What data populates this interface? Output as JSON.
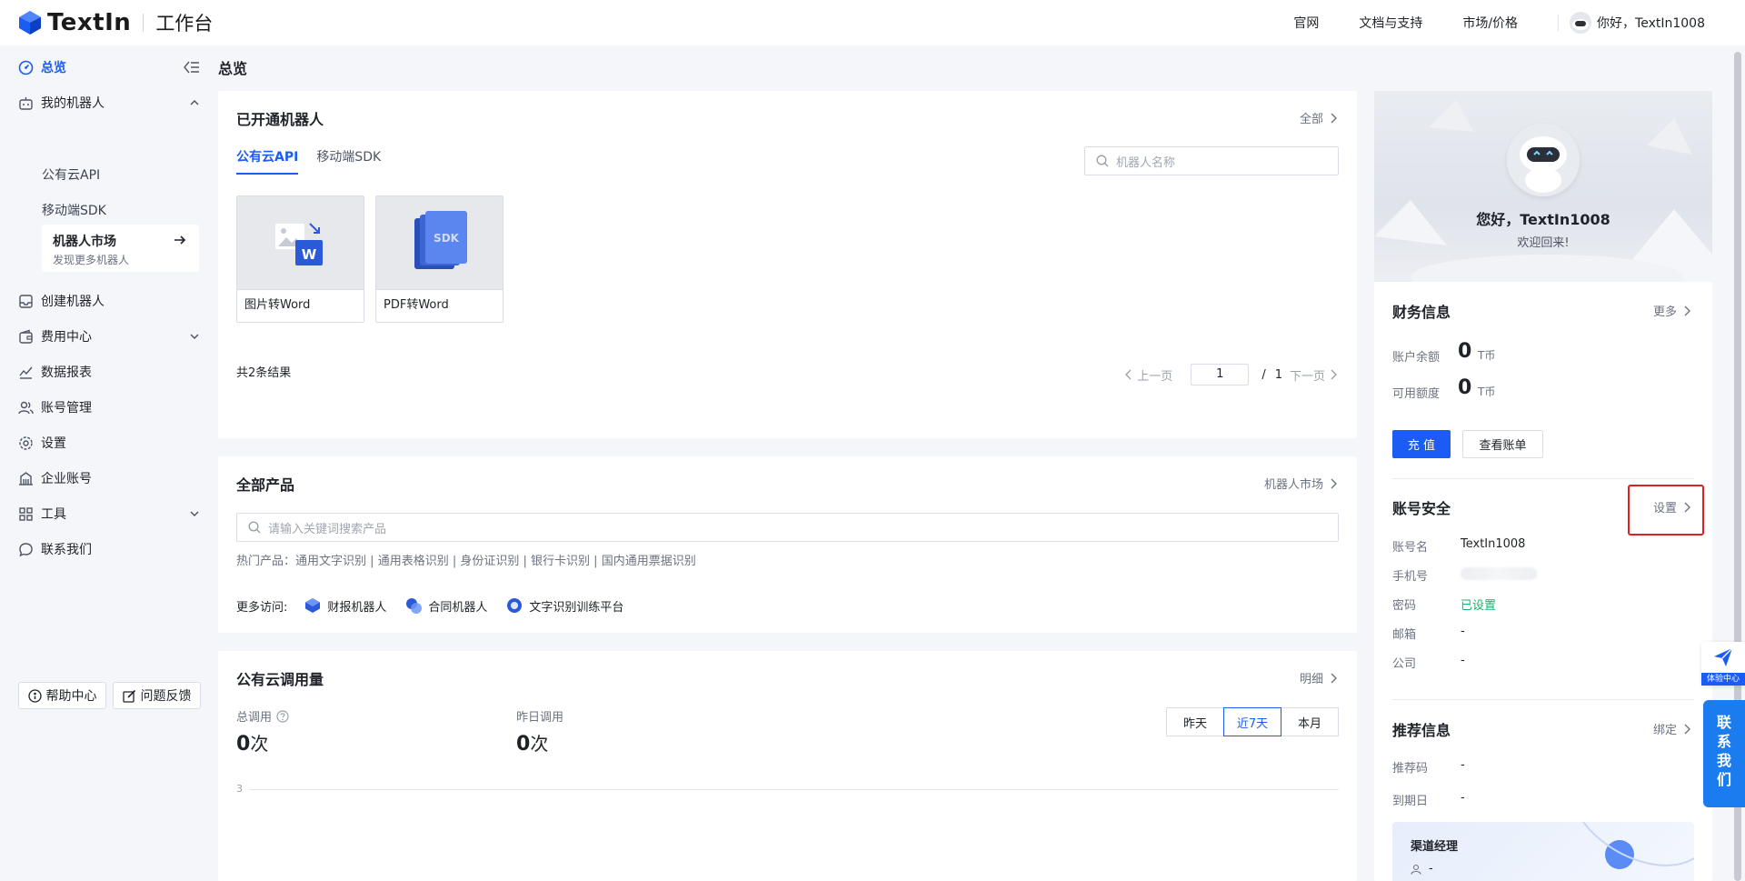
{
  "header": {
    "logo_text": "TextIn",
    "logo_sub": "工作台",
    "nav": [
      "官网",
      "文档与支持",
      "市场/价格"
    ],
    "user_greeting": "你好，TextIn1008"
  },
  "sidebar": {
    "overview": "总览",
    "my_robots": "我的机器人",
    "public_api": "公有云API",
    "mobile_sdk": "移动端SDK",
    "market_title": "机器人市场",
    "market_sub": "发现更多机器人",
    "create_robot": "创建机器人",
    "fee_center": "费用中心",
    "data_report": "数据报表",
    "account_mgmt": "账号管理",
    "settings": "设置",
    "enterprise": "企业账号",
    "tools": "工具",
    "contact": "联系我们",
    "help": "帮助中心",
    "feedback": "问题反馈"
  },
  "page_title": "总览",
  "robots": {
    "title": "已开通机器人",
    "more": "全部",
    "tabs": [
      "公有云API",
      "移动端SDK"
    ],
    "search_placeholder": "机器人名称",
    "items": [
      "图片转Word",
      "PDF转Word"
    ],
    "result_count": "共2条结果",
    "pager_prev": "上一页",
    "pager_page": "1",
    "pager_total": "1",
    "pager_next": "下一页"
  },
  "products": {
    "title": "全部产品",
    "more": "机器人市场",
    "search_placeholder": "请输入关键词搜索产品",
    "hot_label": "热门产品：",
    "hot_items": [
      "通用文字识别",
      "通用表格识别",
      "身份证识别",
      "银行卡识别",
      "国内通用票据识别"
    ],
    "more_visit_label": "更多访问:",
    "more_visit": [
      "财报机器人",
      "合同机器人",
      "文字识别训练平台"
    ]
  },
  "usage": {
    "title": "公有云调用量",
    "more": "明细",
    "total_label": "总调用",
    "total_value": "0",
    "yesterday_label": "昨日调用",
    "yesterday_value": "0",
    "unit": "次",
    "ranges": [
      "昨天",
      "近7天",
      "本月"
    ],
    "axis_max": "3"
  },
  "profile": {
    "greeting": "您好，TextIn1008",
    "welcome": "欢迎回来!"
  },
  "finance": {
    "title": "财务信息",
    "more": "更多",
    "balance_label": "账户余额",
    "balance_value": "0",
    "quota_label": "可用额度",
    "quota_value": "0",
    "unit": "T币",
    "recharge": "充 值",
    "view_bill": "查看账单"
  },
  "security": {
    "title": "账号安全",
    "more": "设置",
    "account_label": "账号名",
    "account_value": "TextIn1008",
    "phone_label": "手机号",
    "password_label": "密码",
    "password_value": "已设置",
    "email_label": "邮箱",
    "email_value": "-",
    "company_label": "公司",
    "company_value": "-"
  },
  "referral": {
    "title": "推荐信息",
    "more": "绑定",
    "code_label": "推荐码",
    "code_value": "-",
    "expire_label": "到期日",
    "expire_value": "-",
    "channel_title": "渠道经理",
    "channel_value": "-"
  },
  "float": {
    "experience": "体验中心",
    "contact": "联系我们"
  },
  "colors": {
    "accent": "#1b5cf5",
    "success": "#19b46c",
    "highlight": "#e02020"
  }
}
